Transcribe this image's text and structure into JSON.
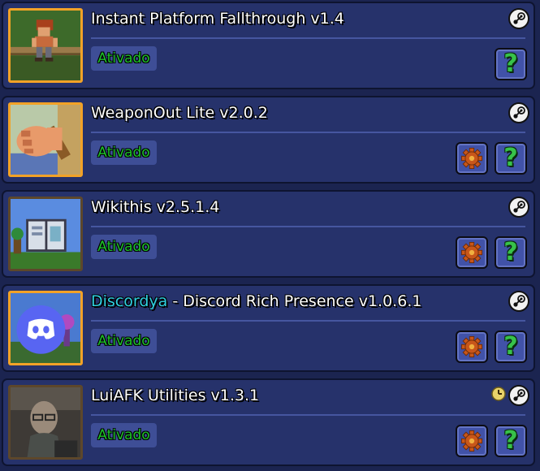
{
  "status_colors": {
    "enabled": "#1ec22a",
    "accent": "#2fd0e0"
  },
  "mods": [
    {
      "name": "Instant Platform Fallthrough v1.4",
      "name_accent": "",
      "status": "Ativado",
      "icon": "pixel-character-icon",
      "has_config": false,
      "has_clock": false,
      "help_label": "?",
      "steam_icon": "steam-icon"
    },
    {
      "name": "WeaponOut Lite v2.0.2",
      "name_accent": "",
      "status": "Ativado",
      "icon": "fist-icon",
      "has_config": true,
      "has_clock": false,
      "help_label": "?",
      "steam_icon": "steam-icon"
    },
    {
      "name": "Wikithis v2.5.1.4",
      "name_accent": "",
      "status": "Ativado",
      "icon": "open-book-icon",
      "has_config": true,
      "has_clock": false,
      "help_label": "?",
      "steam_icon": "steam-icon"
    },
    {
      "name": " - Discord Rich Presence v1.0.6.1",
      "name_accent": "Discordya",
      "status": "Ativado",
      "icon": "discord-icon",
      "has_config": true,
      "has_clock": false,
      "help_label": "?",
      "steam_icon": "steam-icon"
    },
    {
      "name": "LuiAFK Utilities v1.3.1",
      "name_accent": "",
      "status": "Ativado",
      "icon": "portrait-icon",
      "has_config": true,
      "has_clock": true,
      "help_label": "?",
      "steam_icon": "steam-icon"
    }
  ]
}
